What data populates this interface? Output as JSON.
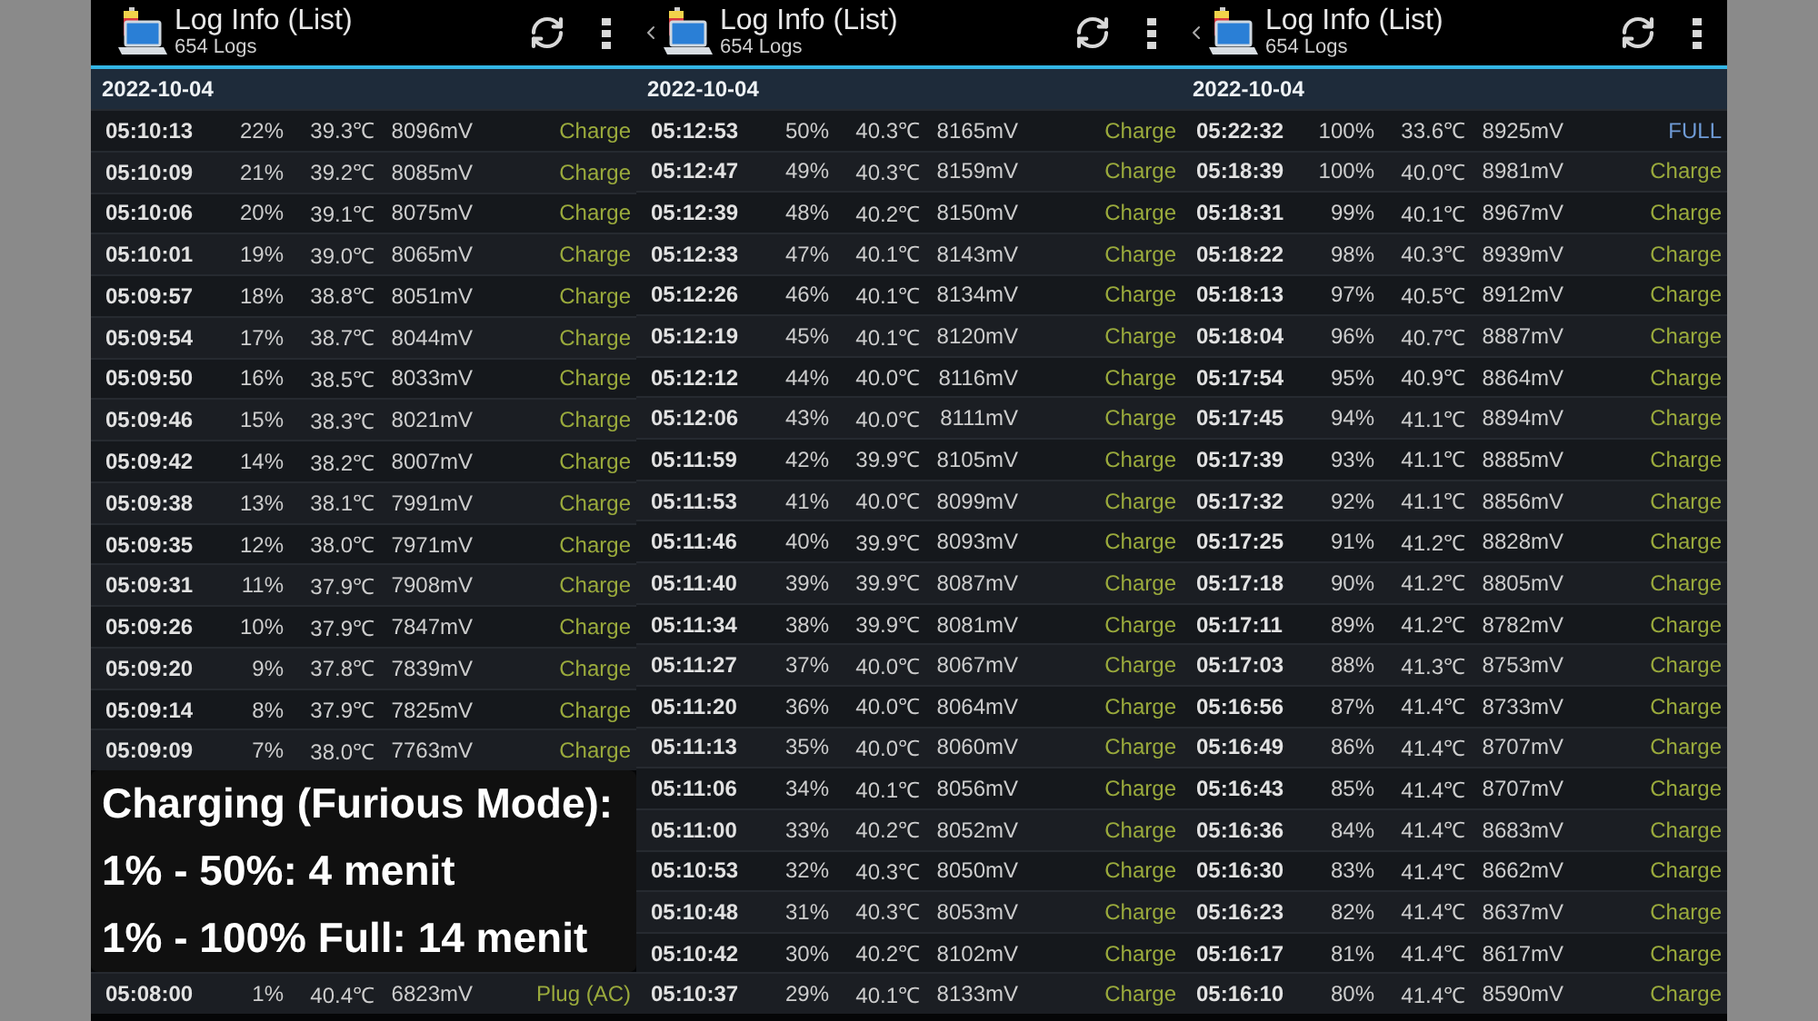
{
  "panels": [
    {
      "header": {
        "title": "Log Info (List)",
        "subtitle": "654 Logs",
        "back": false
      },
      "date": "2022-10-04",
      "rows": [
        {
          "kind": "log",
          "time": "05:10:13",
          "percent": "22%",
          "temperature": "39.3℃",
          "voltage": "8096mV",
          "status": "Charge",
          "color": "#9aaa3c"
        },
        {
          "kind": "log",
          "time": "05:10:09",
          "percent": "21%",
          "temperature": "39.2℃",
          "voltage": "8085mV",
          "status": "Charge",
          "color": "#9aaa3c"
        },
        {
          "kind": "log",
          "time": "05:10:06",
          "percent": "20%",
          "temperature": "39.1℃",
          "voltage": "8075mV",
          "status": "Charge",
          "color": "#9aaa3c"
        },
        {
          "kind": "log",
          "time": "05:10:01",
          "percent": "19%",
          "temperature": "39.0℃",
          "voltage": "8065mV",
          "status": "Charge",
          "color": "#9aaa3c"
        },
        {
          "kind": "log",
          "time": "05:09:57",
          "percent": "18%",
          "temperature": "38.8℃",
          "voltage": "8051mV",
          "status": "Charge",
          "color": "#9aaa3c"
        },
        {
          "kind": "log",
          "time": "05:09:54",
          "percent": "17%",
          "temperature": "38.7℃",
          "voltage": "8044mV",
          "status": "Charge",
          "color": "#9aaa3c"
        },
        {
          "kind": "log",
          "time": "05:09:50",
          "percent": "16%",
          "temperature": "38.5℃",
          "voltage": "8033mV",
          "status": "Charge",
          "color": "#9aaa3c"
        },
        {
          "kind": "log",
          "time": "05:09:46",
          "percent": "15%",
          "temperature": "38.3℃",
          "voltage": "8021mV",
          "status": "Charge",
          "color": "#9aaa3c"
        },
        {
          "kind": "log",
          "time": "05:09:42",
          "percent": "14%",
          "temperature": "38.2℃",
          "voltage": "8007mV",
          "status": "Charge",
          "color": "#9aaa3c"
        },
        {
          "kind": "log",
          "time": "05:09:38",
          "percent": "13%",
          "temperature": "38.1℃",
          "voltage": "7991mV",
          "status": "Charge",
          "color": "#9aaa3c"
        },
        {
          "kind": "log",
          "time": "05:09:35",
          "percent": "12%",
          "temperature": "38.0℃",
          "voltage": "7971mV",
          "status": "Charge",
          "color": "#9aaa3c"
        },
        {
          "kind": "log",
          "time": "05:09:31",
          "percent": "11%",
          "temperature": "37.9℃",
          "voltage": "7908mV",
          "status": "Charge",
          "color": "#9aaa3c"
        },
        {
          "kind": "log",
          "time": "05:09:26",
          "percent": "10%",
          "temperature": "37.9℃",
          "voltage": "7847mV",
          "status": "Charge",
          "color": "#9aaa3c"
        },
        {
          "kind": "log",
          "time": "05:09:20",
          "percent": "9%",
          "temperature": "37.8℃",
          "voltage": "7839mV",
          "status": "Charge",
          "color": "#9aaa3c"
        },
        {
          "kind": "log",
          "time": "05:09:14",
          "percent": "8%",
          "temperature": "37.9℃",
          "voltage": "7825mV",
          "status": "Charge",
          "color": "#9aaa3c"
        },
        {
          "kind": "log",
          "time": "05:09:09",
          "percent": "7%",
          "temperature": "38.0℃",
          "voltage": "7763mV",
          "status": "Charge",
          "color": "#9aaa3c"
        },
        {
          "kind": "caption",
          "lines": [
            "Charging (Furious Mode):",
            "1% - 50%: 4 menit",
            "1% - 100% Full: 14 menit"
          ]
        },
        {
          "kind": "log",
          "time": "05:08:00",
          "percent": "1%",
          "temperature": "40.4℃",
          "voltage": "6823mV",
          "status": "Plug (AC)",
          "color": "#9aaa3c"
        }
      ]
    },
    {
      "header": {
        "title": "Log Info (List)",
        "subtitle": "654 Logs",
        "back": true
      },
      "date": "2022-10-04",
      "rows": [
        {
          "kind": "log",
          "time": "05:12:53",
          "percent": "50%",
          "temperature": "40.3℃",
          "voltage": "8165mV",
          "status": "Charge",
          "color": "#9aaa3c"
        },
        {
          "kind": "log",
          "time": "05:12:47",
          "percent": "49%",
          "temperature": "40.3℃",
          "voltage": "8159mV",
          "status": "Charge",
          "color": "#9aaa3c"
        },
        {
          "kind": "log",
          "time": "05:12:39",
          "percent": "48%",
          "temperature": "40.2℃",
          "voltage": "8150mV",
          "status": "Charge",
          "color": "#9aaa3c"
        },
        {
          "kind": "log",
          "time": "05:12:33",
          "percent": "47%",
          "temperature": "40.1℃",
          "voltage": "8143mV",
          "status": "Charge",
          "color": "#9aaa3c"
        },
        {
          "kind": "log",
          "time": "05:12:26",
          "percent": "46%",
          "temperature": "40.1℃",
          "voltage": "8134mV",
          "status": "Charge",
          "color": "#9aaa3c"
        },
        {
          "kind": "log",
          "time": "05:12:19",
          "percent": "45%",
          "temperature": "40.1℃",
          "voltage": "8120mV",
          "status": "Charge",
          "color": "#9aaa3c"
        },
        {
          "kind": "log",
          "time": "05:12:12",
          "percent": "44%",
          "temperature": "40.0℃",
          "voltage": "8116mV",
          "status": "Charge",
          "color": "#9aaa3c"
        },
        {
          "kind": "log",
          "time": "05:12:06",
          "percent": "43%",
          "temperature": "40.0℃",
          "voltage": "8111mV",
          "status": "Charge",
          "color": "#9aaa3c"
        },
        {
          "kind": "log",
          "time": "05:11:59",
          "percent": "42%",
          "temperature": "39.9℃",
          "voltage": "8105mV",
          "status": "Charge",
          "color": "#9aaa3c"
        },
        {
          "kind": "log",
          "time": "05:11:53",
          "percent": "41%",
          "temperature": "40.0℃",
          "voltage": "8099mV",
          "status": "Charge",
          "color": "#9aaa3c"
        },
        {
          "kind": "log",
          "time": "05:11:46",
          "percent": "40%",
          "temperature": "39.9℃",
          "voltage": "8093mV",
          "status": "Charge",
          "color": "#9aaa3c"
        },
        {
          "kind": "log",
          "time": "05:11:40",
          "percent": "39%",
          "temperature": "39.9℃",
          "voltage": "8087mV",
          "status": "Charge",
          "color": "#9aaa3c"
        },
        {
          "kind": "log",
          "time": "05:11:34",
          "percent": "38%",
          "temperature": "39.9℃",
          "voltage": "8081mV",
          "status": "Charge",
          "color": "#9aaa3c"
        },
        {
          "kind": "log",
          "time": "05:11:27",
          "percent": "37%",
          "temperature": "40.0℃",
          "voltage": "8067mV",
          "status": "Charge",
          "color": "#9aaa3c"
        },
        {
          "kind": "log",
          "time": "05:11:20",
          "percent": "36%",
          "temperature": "40.0℃",
          "voltage": "8064mV",
          "status": "Charge",
          "color": "#9aaa3c"
        },
        {
          "kind": "log",
          "time": "05:11:13",
          "percent": "35%",
          "temperature": "40.0℃",
          "voltage": "8060mV",
          "status": "Charge",
          "color": "#9aaa3c"
        },
        {
          "kind": "log",
          "time": "05:11:06",
          "percent": "34%",
          "temperature": "40.1℃",
          "voltage": "8056mV",
          "status": "Charge",
          "color": "#9aaa3c"
        },
        {
          "kind": "log",
          "time": "05:11:00",
          "percent": "33%",
          "temperature": "40.2℃",
          "voltage": "8052mV",
          "status": "Charge",
          "color": "#9aaa3c"
        },
        {
          "kind": "log",
          "time": "05:10:53",
          "percent": "32%",
          "temperature": "40.3℃",
          "voltage": "8050mV",
          "status": "Charge",
          "color": "#9aaa3c"
        },
        {
          "kind": "log",
          "time": "05:10:48",
          "percent": "31%",
          "temperature": "40.3℃",
          "voltage": "8053mV",
          "status": "Charge",
          "color": "#9aaa3c"
        },
        {
          "kind": "log",
          "time": "05:10:42",
          "percent": "30%",
          "temperature": "40.2℃",
          "voltage": "8102mV",
          "status": "Charge",
          "color": "#9aaa3c"
        },
        {
          "kind": "log",
          "time": "05:10:37",
          "percent": "29%",
          "temperature": "40.1℃",
          "voltage": "8133mV",
          "status": "Charge",
          "color": "#9aaa3c"
        }
      ]
    },
    {
      "header": {
        "title": "Log Info (List)",
        "subtitle": "654 Logs",
        "back": true
      },
      "date": "2022-10-04",
      "rows": [
        {
          "kind": "log",
          "time": "05:22:32",
          "percent": "100%",
          "temperature": "33.6℃",
          "voltage": "8925mV",
          "status": "FULL",
          "color": "#6f9bd6"
        },
        {
          "kind": "log",
          "time": "05:18:39",
          "percent": "100%",
          "temperature": "40.0℃",
          "voltage": "8981mV",
          "status": "Charge",
          "color": "#9aaa3c"
        },
        {
          "kind": "log",
          "time": "05:18:31",
          "percent": "99%",
          "temperature": "40.1℃",
          "voltage": "8967mV",
          "status": "Charge",
          "color": "#9aaa3c"
        },
        {
          "kind": "log",
          "time": "05:18:22",
          "percent": "98%",
          "temperature": "40.3℃",
          "voltage": "8939mV",
          "status": "Charge",
          "color": "#9aaa3c"
        },
        {
          "kind": "log",
          "time": "05:18:13",
          "percent": "97%",
          "temperature": "40.5℃",
          "voltage": "8912mV",
          "status": "Charge",
          "color": "#9aaa3c"
        },
        {
          "kind": "log",
          "time": "05:18:04",
          "percent": "96%",
          "temperature": "40.7℃",
          "voltage": "8887mV",
          "status": "Charge",
          "color": "#9aaa3c"
        },
        {
          "kind": "log",
          "time": "05:17:54",
          "percent": "95%",
          "temperature": "40.9℃",
          "voltage": "8864mV",
          "status": "Charge",
          "color": "#9aaa3c"
        },
        {
          "kind": "log",
          "time": "05:17:45",
          "percent": "94%",
          "temperature": "41.1℃",
          "voltage": "8894mV",
          "status": "Charge",
          "color": "#9aaa3c"
        },
        {
          "kind": "log",
          "time": "05:17:39",
          "percent": "93%",
          "temperature": "41.1℃",
          "voltage": "8885mV",
          "status": "Charge",
          "color": "#9aaa3c"
        },
        {
          "kind": "log",
          "time": "05:17:32",
          "percent": "92%",
          "temperature": "41.1℃",
          "voltage": "8856mV",
          "status": "Charge",
          "color": "#9aaa3c"
        },
        {
          "kind": "log",
          "time": "05:17:25",
          "percent": "91%",
          "temperature": "41.2℃",
          "voltage": "8828mV",
          "status": "Charge",
          "color": "#9aaa3c"
        },
        {
          "kind": "log",
          "time": "05:17:18",
          "percent": "90%",
          "temperature": "41.2℃",
          "voltage": "8805mV",
          "status": "Charge",
          "color": "#9aaa3c"
        },
        {
          "kind": "log",
          "time": "05:17:11",
          "percent": "89%",
          "temperature": "41.2℃",
          "voltage": "8782mV",
          "status": "Charge",
          "color": "#9aaa3c"
        },
        {
          "kind": "log",
          "time": "05:17:03",
          "percent": "88%",
          "temperature": "41.3℃",
          "voltage": "8753mV",
          "status": "Charge",
          "color": "#9aaa3c"
        },
        {
          "kind": "log",
          "time": "05:16:56",
          "percent": "87%",
          "temperature": "41.4℃",
          "voltage": "8733mV",
          "status": "Charge",
          "color": "#9aaa3c"
        },
        {
          "kind": "log",
          "time": "05:16:49",
          "percent": "86%",
          "temperature": "41.4℃",
          "voltage": "8707mV",
          "status": "Charge",
          "color": "#9aaa3c"
        },
        {
          "kind": "log",
          "time": "05:16:43",
          "percent": "85%",
          "temperature": "41.4℃",
          "voltage": "8707mV",
          "status": "Charge",
          "color": "#9aaa3c"
        },
        {
          "kind": "log",
          "time": "05:16:36",
          "percent": "84%",
          "temperature": "41.4℃",
          "voltage": "8683mV",
          "status": "Charge",
          "color": "#9aaa3c"
        },
        {
          "kind": "log",
          "time": "05:16:30",
          "percent": "83%",
          "temperature": "41.4℃",
          "voltage": "8662mV",
          "status": "Charge",
          "color": "#9aaa3c"
        },
        {
          "kind": "log",
          "time": "05:16:23",
          "percent": "82%",
          "temperature": "41.4℃",
          "voltage": "8637mV",
          "status": "Charge",
          "color": "#9aaa3c"
        },
        {
          "kind": "log",
          "time": "05:16:17",
          "percent": "81%",
          "temperature": "41.4℃",
          "voltage": "8617mV",
          "status": "Charge",
          "color": "#9aaa3c"
        },
        {
          "kind": "log",
          "time": "05:16:10",
          "percent": "80%",
          "temperature": "41.4℃",
          "voltage": "8590mV",
          "status": "Charge",
          "color": "#9aaa3c"
        }
      ]
    }
  ]
}
